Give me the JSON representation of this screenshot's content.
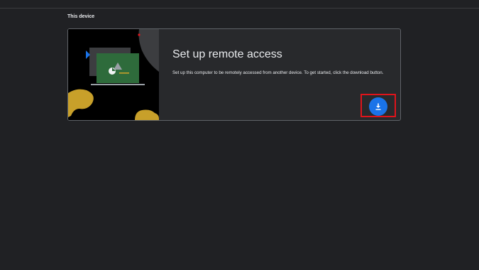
{
  "section": {
    "title": "This device"
  },
  "card": {
    "title": "Set up remote access",
    "description": "Set up this computer to be remotely accessed from another device. To get started, click the download button.",
    "download_icon": "download-icon"
  },
  "colors": {
    "background": "#202124",
    "card_background": "#28292c",
    "card_border": "#5f6368",
    "accent": "#1a73e8",
    "highlight": "#e0141b",
    "illustration_green": "#2e6b3b",
    "illustration_yellow": "#c8a02a"
  }
}
